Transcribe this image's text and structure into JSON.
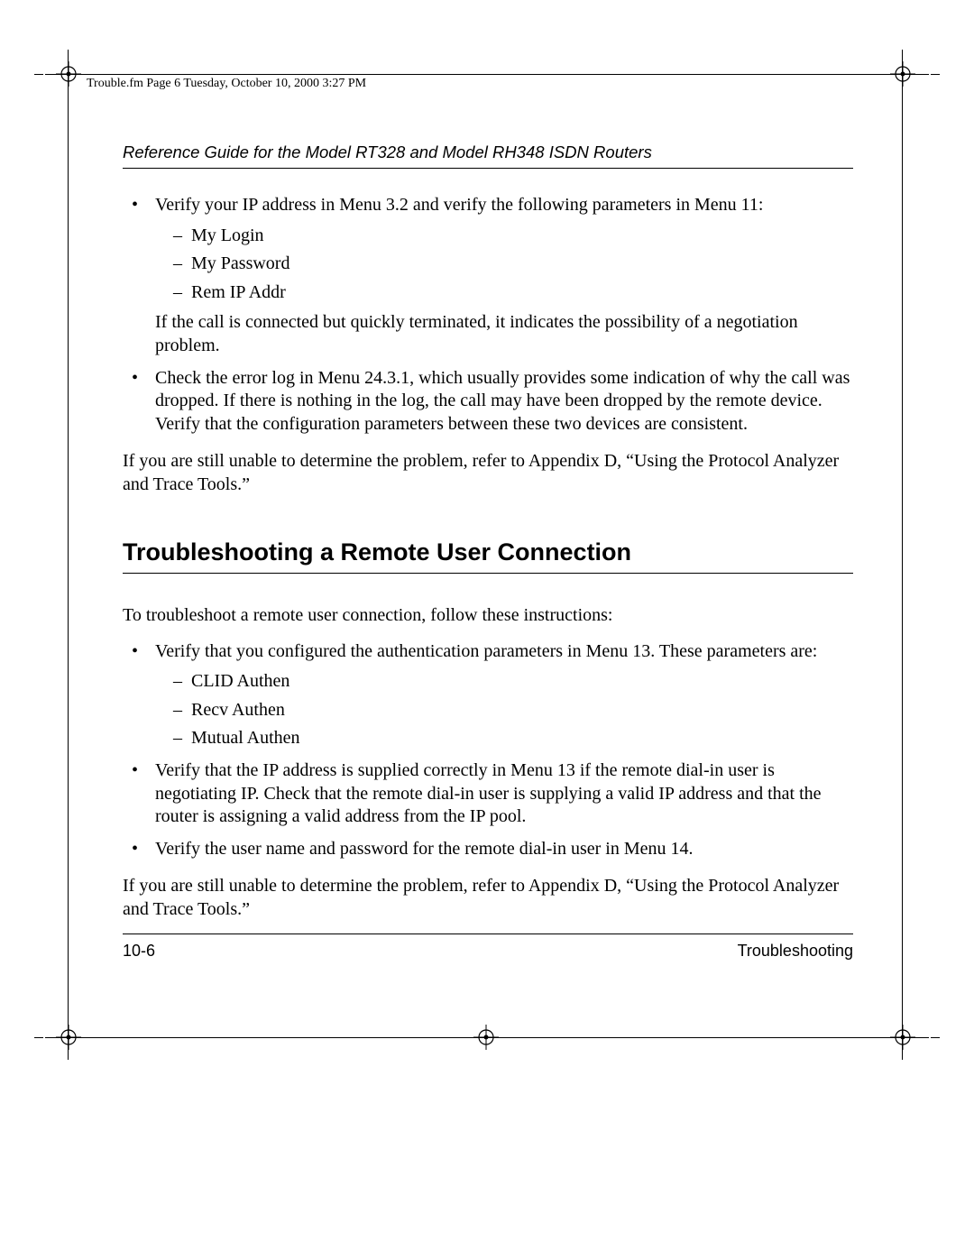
{
  "meta": {
    "header_line": "Trouble.fm  Page 6  Tuesday, October 10, 2000  3:27 PM"
  },
  "running_head": "Reference Guide for the Model RT328 and Model RH348 ISDN Routers",
  "bullets1": {
    "b1_intro": "Verify your IP address in Menu 3.2 and verify the following parameters in Menu 11:",
    "sub": {
      "s1": "My Login",
      "s2": "My Password",
      "s3": "Rem IP Addr"
    },
    "b1_after": "If the call is connected but quickly terminated, it indicates the possibility of a negotiation problem.",
    "b2": "Check the error log in Menu 24.3.1, which usually provides some indication of why the call was dropped. If there is nothing in the log, the call may have been dropped by the remote device. Verify that the configuration parameters between these two devices are consistent."
  },
  "para1": "If you are still unable to determine the problem, refer to Appendix D, “Using the Protocol Analyzer and Trace Tools.”",
  "section_title": "Troubleshooting a Remote User Connection",
  "para2": "To troubleshoot a remote user connection, follow these instructions:",
  "bullets2": {
    "b1_intro": "Verify that you configured the authentication parameters in Menu 13. These parameters are:",
    "sub": {
      "s1": "CLID Authen",
      "s2": "Recv Authen",
      "s3": "Mutual Authen"
    },
    "b2": "Verify that the IP address is supplied correctly in Menu 13 if the remote dial-in user is negotiating IP. Check that the remote dial-in user is supplying a valid IP address and that the router is assigning a valid address from the IP pool.",
    "b3": "Verify the user name and password for the remote dial-in user in Menu 14."
  },
  "para3": "If you are still unable to determine the problem, refer to Appendix D, “Using the Protocol Analyzer and Trace Tools.”",
  "footer": {
    "page": "10-6",
    "section": "Troubleshooting"
  }
}
